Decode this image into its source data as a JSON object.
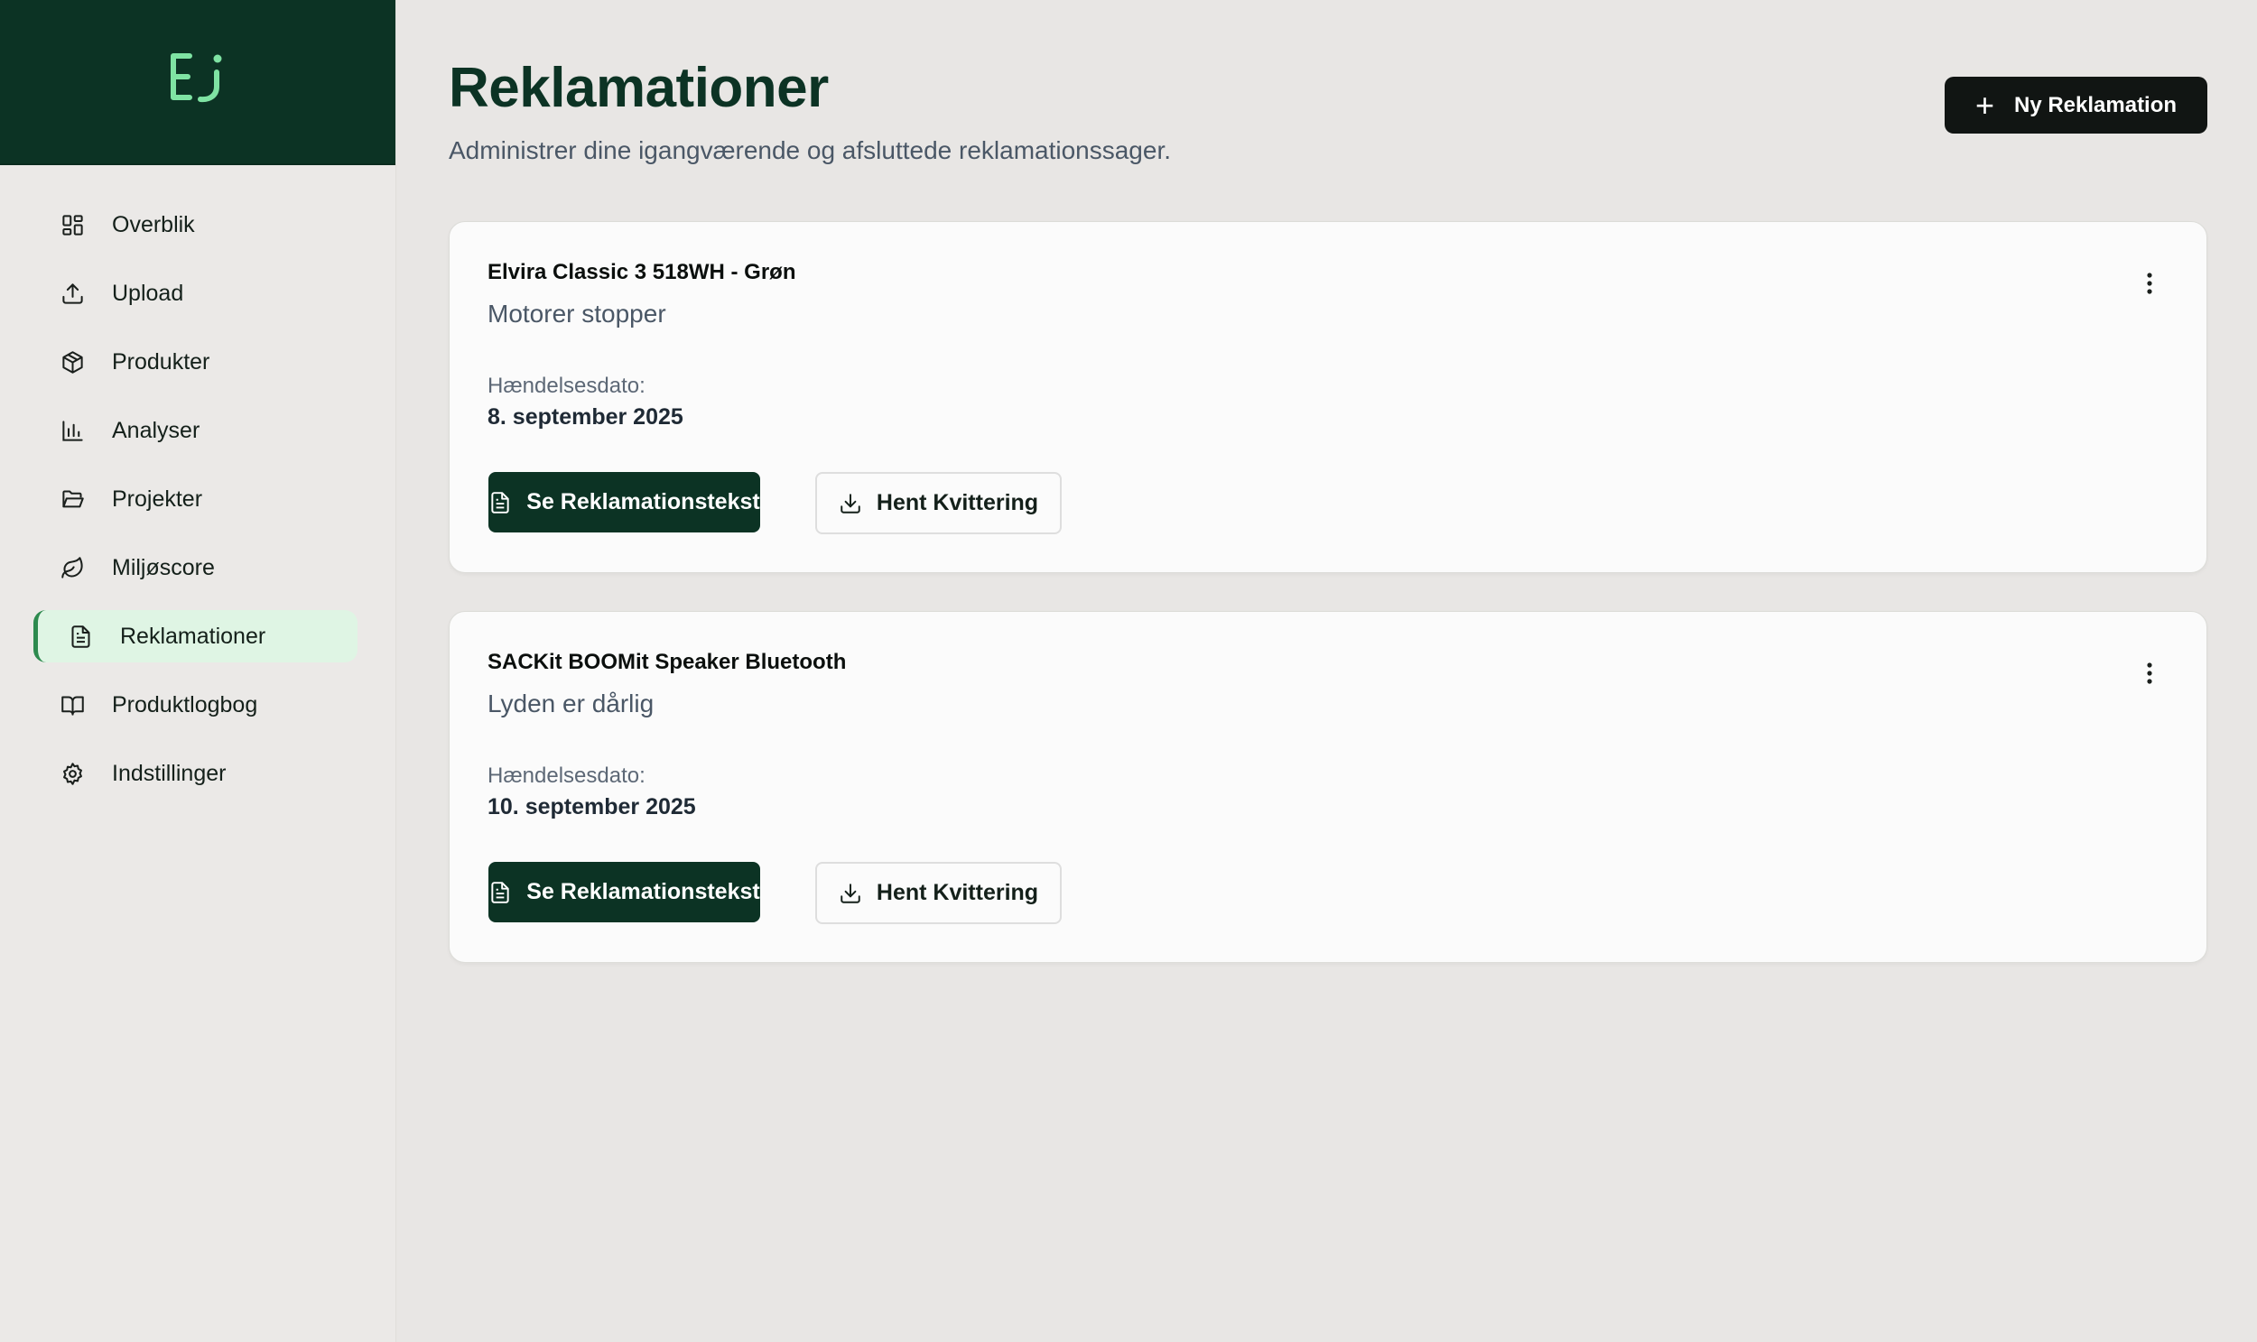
{
  "brand": {
    "logo_icon": "ej-smile-logo",
    "colors": {
      "primary": "#0c3324",
      "accent": "#7fe3a3",
      "active_bg": "#dff5e4",
      "active_border": "#2d8a4e"
    }
  },
  "sidebar": {
    "items": [
      {
        "label": "Overblik",
        "icon": "dashboard-icon",
        "active": false
      },
      {
        "label": "Upload",
        "icon": "upload-icon",
        "active": false
      },
      {
        "label": "Produkter",
        "icon": "package-icon",
        "active": false
      },
      {
        "label": "Analyser",
        "icon": "bar-chart-icon",
        "active": false
      },
      {
        "label": "Projekter",
        "icon": "folder-open-icon",
        "active": false
      },
      {
        "label": "Miljøscore",
        "icon": "leaf-icon",
        "active": false
      },
      {
        "label": "Reklamationer",
        "icon": "file-text-icon",
        "active": true
      },
      {
        "label": "Produktlogbog",
        "icon": "book-open-icon",
        "active": false
      },
      {
        "label": "Indstillinger",
        "icon": "gear-icon",
        "active": false
      }
    ]
  },
  "header": {
    "title": "Reklamationer",
    "subtitle": "Administrer dine igangværende og afsluttede reklamationssager.",
    "new_button_label": "Ny Reklamation"
  },
  "claims": [
    {
      "product": "Elvira Classic 3 518WH - Grøn",
      "issue": "Motorer stopper",
      "date_label": "Hændelsesdato:",
      "date": "8. september 2025",
      "primary_label": "Se Reklamationstekst",
      "secondary_label": "Hent Kvittering"
    },
    {
      "product": "SACKit BOOMit Speaker Bluetooth",
      "issue": "Lyden er dårlig",
      "date_label": "Hændelsesdato:",
      "date": "10. september 2025",
      "primary_label": "Se Reklamationstekst",
      "secondary_label": "Hent Kvittering"
    }
  ]
}
